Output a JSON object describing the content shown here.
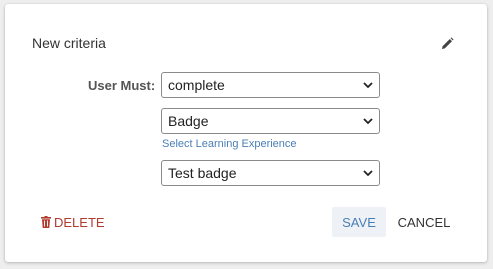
{
  "card": {
    "title": "New criteria",
    "edit_icon": "pencil-icon"
  },
  "form": {
    "user_must_label": "User Must:",
    "action_select": {
      "value": "complete"
    },
    "type_select": {
      "value": "Badge"
    },
    "helper_link": "Select Learning Experience",
    "item_select": {
      "value": "Test badge"
    }
  },
  "actions": {
    "delete_label": "DELETE",
    "delete_icon": "trash-icon",
    "save_label": "SAVE",
    "cancel_label": "CANCEL"
  },
  "colors": {
    "accent": "#4a7fb5",
    "danger": "#b03b2e",
    "save_bg": "#eef1f5"
  }
}
